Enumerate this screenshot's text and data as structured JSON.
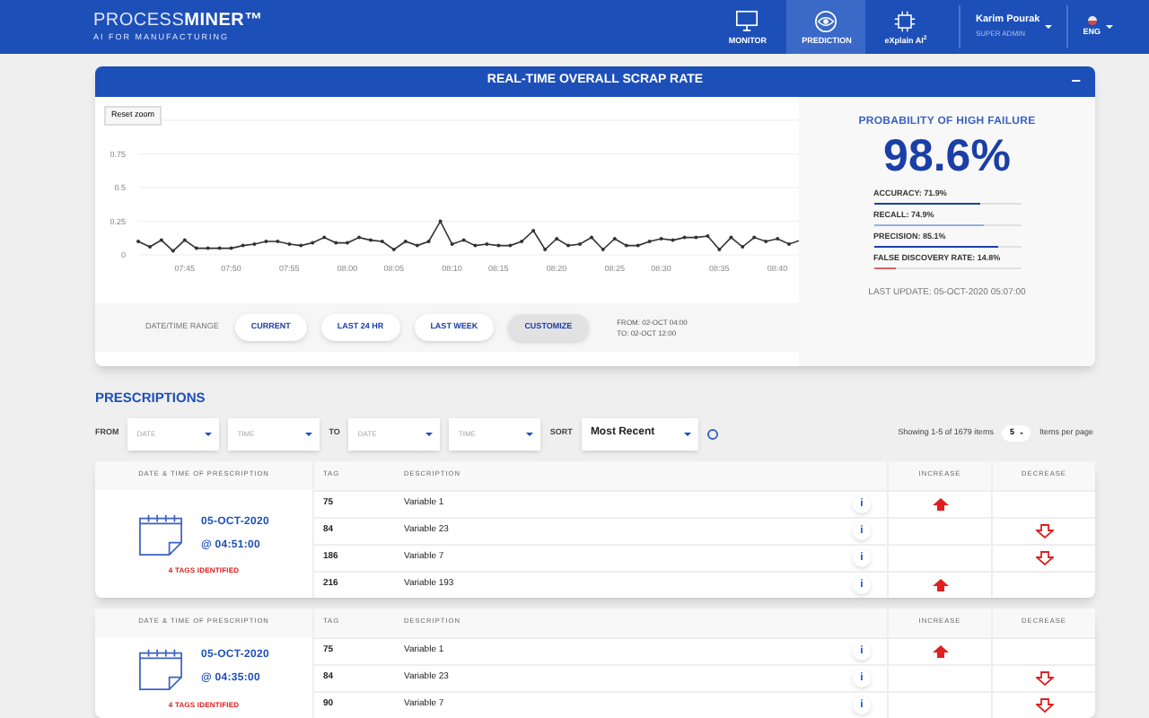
{
  "header": {
    "brand_light": "PROCESS",
    "brand_bold": "MINER™",
    "tagline": "AI FOR MANUFACTURING",
    "nav": [
      {
        "label": "MONITOR",
        "selected": false
      },
      {
        "label": "PREDICTION",
        "selected": true
      },
      {
        "label": "eXplain AI$^{2}$",
        "selected": false
      }
    ],
    "user": {
      "name": "Karim Pourak",
      "role": "SUPER ADMIN"
    },
    "language": "ENG"
  },
  "scrap_panel": {
    "title": "REAL-TIME OVERALL SCRAP RATE",
    "collapse": "−",
    "reset_zoom": "Reset zoom",
    "chart_data": {
      "type": "line",
      "grid": true,
      "ylim": [
        0,
        1
      ],
      "yticks": [
        0,
        0.25,
        0.5,
        0.75
      ],
      "categories": [
        null,
        null,
        null,
        null,
        "07:45",
        null,
        null,
        null,
        "07:50",
        null,
        null,
        null,
        null,
        "07:55",
        null,
        null,
        null,
        null,
        "08:00",
        null,
        null,
        null,
        "08:05",
        null,
        null,
        null,
        null,
        "08:10",
        null,
        null,
        null,
        "08:15",
        null,
        null,
        null,
        null,
        "08:20",
        null,
        null,
        null,
        null,
        "08:25",
        null,
        null,
        null,
        "08:30",
        null,
        null,
        null,
        null,
        "08:35",
        null,
        null,
        null,
        null,
        "08:40",
        null,
        null
      ],
      "series": [
        {
          "color": "#333333",
          "values": [
            0.1,
            0.06,
            0.11,
            0.03,
            0.11,
            0.05,
            0.05,
            0.05,
            0.05,
            0.07,
            0.08,
            0.1,
            0.1,
            0.08,
            0.07,
            0.09,
            0.13,
            0.09,
            0.09,
            0.13,
            0.11,
            0.1,
            0.04,
            0.1,
            0.07,
            0.1,
            0.25,
            0.08,
            0.11,
            0.07,
            0.08,
            0.07,
            0.07,
            0.1,
            0.18,
            0.04,
            0.12,
            0.07,
            0.08,
            0.13,
            0.04,
            0.12,
            0.07,
            0.07,
            0.1,
            0.12,
            0.11,
            0.13,
            0.13,
            0.14,
            0.04,
            0.13,
            0.06,
            0.13,
            0.1,
            0.12,
            0.08,
            0.11
          ]
        }
      ]
    },
    "range_label": "DATE/TIME RANGE",
    "range_buttons": [
      {
        "label": "CURRENT",
        "selected": false
      },
      {
        "label": "LAST 24 HR",
        "selected": false
      },
      {
        "label": "LAST WEEK",
        "selected": false
      },
      {
        "label": "CUSTOMIZE",
        "selected": true
      }
    ],
    "from": "FROM: 02-OCT 04:00",
    "to": "TO: 02-OCT 12:00",
    "probability_title": "PROBABILITY OF HIGH FAILURE",
    "probability": "98.6%",
    "metrics": [
      {
        "label": "ACCURACY: 71.9%",
        "level": 0.72,
        "color": "#1a3fa6"
      },
      {
        "label": "RECALL: 74.9%",
        "level": 0.75,
        "color": "#9aaee0"
      },
      {
        "label": "PRECISION: 85.1%",
        "level": 0.85,
        "color": "#1a3fa6"
      },
      {
        "label": "FALSE DISCOVERY RATE: 14.8%",
        "level": 0.148,
        "color": "#e06060"
      }
    ],
    "last_update": "LAST UPDATE: 05-OCT-2020 05:07:00"
  },
  "prescriptions": {
    "title": "PRESCRIPTIONS",
    "filters": {
      "from": "FROM",
      "from_date": "DATE",
      "from_time": "TIME",
      "to": "TO",
      "to_date": "DATE",
      "to_time": "TIME",
      "sort": "SORT",
      "sort_value": "Most Recent"
    },
    "showing": "Showing 1-5 of 1679 items",
    "per_page": "5",
    "per_page_label": "Items per page",
    "cards": [
      {
        "columns": [
          "DATE & TIME OF PRESCRIPTION",
          "TAG",
          "DESCRIPTION",
          "INCREASE",
          "DECREASE"
        ],
        "date": "05-OCT-2020",
        "time": "@ 04:51:00",
        "tags": "4 TAGS IDENTIFIED",
        "rows": [
          {
            "tag": "75",
            "description": "Variable 1",
            "info": "i",
            "increase": true,
            "decrease": false
          },
          {
            "tag": "84",
            "description": "Variable 23",
            "info": "i",
            "increase": false,
            "decrease": true
          },
          {
            "tag": "186",
            "description": "Variable 7",
            "info": "i",
            "increase": false,
            "decrease": true
          },
          {
            "tag": "216",
            "description": "Variable 193",
            "info": "i",
            "increase": true,
            "decrease": false
          }
        ]
      },
      {
        "columns": [
          "DATE & TIME OF PRESCRIPTION",
          "TAG",
          "DESCRIPTION",
          "INCREASE",
          "DECREASE"
        ],
        "date": "05-OCT-2020",
        "time": "@ 04:35:00",
        "tags": "4 TAGS IDENTIFIED",
        "rows": [
          {
            "tag": "75",
            "description": "Variable 1",
            "info": "i",
            "increase": true,
            "decrease": false
          },
          {
            "tag": "84",
            "description": "Variable 23",
            "info": "i",
            "increase": false,
            "decrease": true
          },
          {
            "tag": "90",
            "description": "Variable 7",
            "info": "i",
            "increase": false,
            "decrease": true
          }
        ]
      }
    ]
  }
}
